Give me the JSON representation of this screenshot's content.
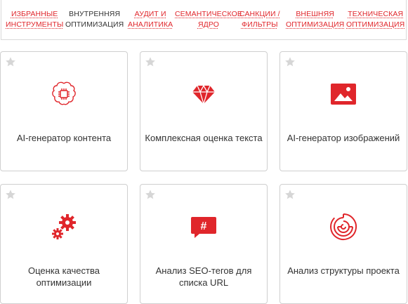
{
  "tabs": [
    {
      "lines": [
        "ИЗБРАННЫЕ",
        "ИНСТРУМЕНТЫ"
      ],
      "active": false
    },
    {
      "lines": [
        "ВНУТРЕННЯЯ",
        "ОПТИМИЗАЦИЯ"
      ],
      "active": true
    },
    {
      "lines": [
        "АУДИТ И",
        "АНАЛИТИКА"
      ],
      "active": false
    },
    {
      "lines": [
        "СЕМАНТИЧЕСКОЕ",
        "ЯДРО"
      ],
      "active": false
    },
    {
      "lines": [
        "САНКЦИИ /",
        "ФИЛЬТРЫ"
      ],
      "active": false
    },
    {
      "lines": [
        "ВНЕШНЯЯ",
        "ОПТИМИЗАЦИЯ"
      ],
      "active": false
    },
    {
      "lines": [
        "ТЕХНИЧЕСКАЯ",
        "ОПТИМИЗАЦИЯ"
      ],
      "active": false
    }
  ],
  "cards": [
    {
      "title": "AI-генератор контента",
      "icon": "brain-chip-icon"
    },
    {
      "title": "Комплексная оценка текста",
      "icon": "gem-icon"
    },
    {
      "title": "AI-генератор изображений",
      "icon": "image-icon"
    },
    {
      "title": "Оценка качества оптимизации",
      "icon": "gears-icon"
    },
    {
      "title": "Анализ SEO-тегов для списка URL",
      "icon": "hashtag-bubble-icon"
    },
    {
      "title": "Анализ структуры проекта",
      "icon": "maze-icon"
    }
  ],
  "colors": {
    "accent": "#e0262b",
    "text": "#333333",
    "star": "#d6d6d6",
    "border": "#cfcfcf"
  }
}
